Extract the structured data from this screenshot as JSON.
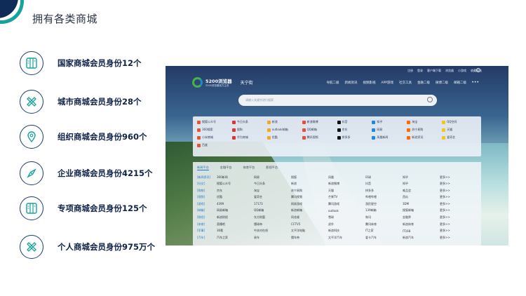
{
  "page": {
    "title": "拥有各类商城"
  },
  "features": [
    {
      "icon": "columns-icon",
      "label": "国家商城会员身份12个"
    },
    {
      "icon": "ruler-pencil-icon",
      "label": "城市商城会员身份28个"
    },
    {
      "icon": "location-pin-icon",
      "label": "组织商城会员身份960个"
    },
    {
      "icon": "compass-icon",
      "label": "企业商城会员身份4215个"
    },
    {
      "icon": "columns-icon",
      "label": "专项商城会员身份125个"
    },
    {
      "icon": "ruler-pencil-icon",
      "label": "个人商城会员身份975万个"
    }
  ],
  "screenshot": {
    "topnav": [
      "注册",
      "登录",
      "客户端下载",
      "浏览器",
      "小游戏",
      "收藏网站"
    ],
    "logo": {
      "name": "5200浏览器",
      "sub": "5200浏览器官方主页",
      "city": "天宁街"
    },
    "catnav": [
      "导航二级",
      "新闻资讯",
      "视频影视",
      "APP游戏",
      "社交工具",
      "金融二级",
      "微博二级",
      "邮箱二级"
    ],
    "search_placeholder": "请输入关键字进行搜索",
    "sites": [
      "搜狐公众号",
      "今日头条",
      "新浪",
      "新浪微博",
      "抖音",
      "知乎",
      "淘宝",
      "QQ空间",
      "360搜索",
      "搜狗",
      "outlook邮箱",
      "QQ邮箱",
      "京东",
      "网易",
      "苏宁易购",
      "天猫",
      "小米商城",
      "华为商城",
      "优酷",
      "腾讯视频",
      "拼多多",
      "凤凰新闻",
      "新浪资讯",
      "爱奇艺",
      "百度"
    ],
    "tabs": [
      "新闻平台",
      "金融平台",
      "体育平台",
      "影视平台"
    ],
    "rows": [
      {
        "label": "[新闻资讯]",
        "cells": [
          "360新闻",
          "网易",
          "搜狐",
          "凤凰",
          "环球",
          "知乎",
          "更多>>"
        ]
      },
      {
        "label": "[社交]",
        "cells": [
          "搜狐公众号",
          "今日头条",
          "新浪",
          "新浪微博",
          "抖音",
          "知乎",
          "更多>>"
        ]
      },
      {
        "label": "[购物]",
        "cells": [
          "京东",
          "淘宝",
          "苏宁易购",
          "天猫",
          "拼多多",
          "唯品会",
          "更多>>"
        ]
      },
      {
        "label": "[视频]",
        "cells": [
          "优酷",
          "爱奇艺",
          "腾讯视频",
          "芒果TV",
          "哔哩哔哩",
          "西瓜",
          "更多>>"
        ]
      },
      {
        "label": "[游戏]",
        "cells": [
          "4399",
          "17173",
          "网易游戏",
          "腾讯游戏",
          "游民星空",
          "3DM",
          "更多>>"
        ]
      },
      {
        "label": "[邮箱]",
        "cells": [
          "网易邮箱",
          "QQ邮箱",
          "新浪邮箱",
          "outlook",
          "139邮箱",
          "搜狐邮箱",
          "更多>>"
        ]
      },
      {
        "label": "[财经]",
        "cells": [
          "新浪财经",
          "东方财富",
          "同花顺",
          "雪球",
          "和讯",
          "金融界",
          "更多>>"
        ]
      },
      {
        "label": "[体育]",
        "cells": [
          "直播吧",
          "懂球帝",
          "CCTV5",
          "虎扑",
          "腾讯体育",
          "新浪体育",
          "更多>>"
        ]
      },
      {
        "label": "[军事]",
        "cells": [
          "36氪",
          "中关村在线",
          "太平洋电脑",
          "新浪科技",
          "IT之家",
          "IT168",
          "更多>>"
        ]
      },
      {
        "label": "[汽车]",
        "cells": [
          "汽车之家",
          "易车",
          "懂车帝",
          "太平洋汽车",
          "爱卡汽车",
          "新浪汽车",
          "更多>>"
        ]
      }
    ]
  }
}
